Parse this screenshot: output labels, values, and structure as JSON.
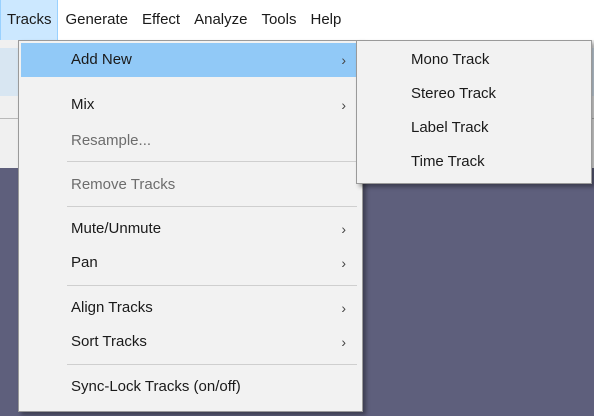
{
  "menubar": {
    "items": [
      {
        "label": "Tracks"
      },
      {
        "label": "Generate"
      },
      {
        "label": "Effect"
      },
      {
        "label": "Analyze"
      },
      {
        "label": "Tools"
      },
      {
        "label": "Help"
      }
    ]
  },
  "tracks_menu": {
    "items": [
      {
        "label": "Add New",
        "arrow": "›"
      },
      {
        "label": "Mix",
        "arrow": "›"
      },
      {
        "label": "Resample..."
      },
      {
        "label": "Remove Tracks"
      },
      {
        "label": "Mute/Unmute",
        "arrow": "›"
      },
      {
        "label": "Pan",
        "arrow": "›"
      },
      {
        "label": "Align Tracks",
        "arrow": "›"
      },
      {
        "label": "Sort Tracks",
        "arrow": "›"
      },
      {
        "label": "Sync-Lock Tracks (on/off)"
      }
    ]
  },
  "add_new_submenu": {
    "items": [
      {
        "label": "Mono Track"
      },
      {
        "label": "Stereo Track"
      },
      {
        "label": "Label Track"
      },
      {
        "label": "Time Track"
      }
    ]
  },
  "colors": {
    "menu_highlight": "#91c9f7",
    "menubar_active": "#cce8ff",
    "canvas_background": "#5e5f7c",
    "menu_background": "#f2f2f2",
    "disabled_text": "#6d6d6d"
  }
}
